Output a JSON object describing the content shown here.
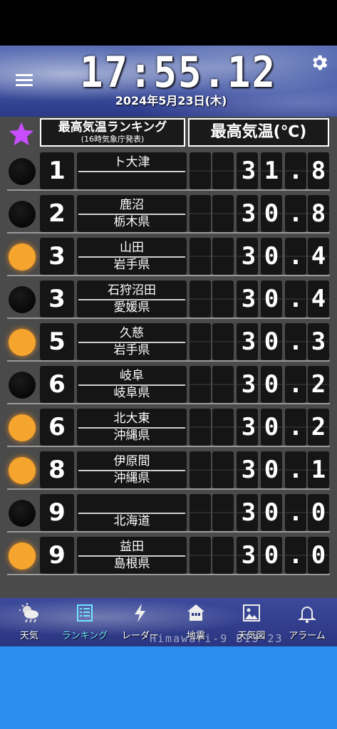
{
  "header": {
    "time": "17:55.12",
    "date": "2024年5月23日(木)"
  },
  "table": {
    "title_left": "最高気温ランキング",
    "subtitle_left": "(16時気象庁発表)",
    "title_right": "最高気温(℃)"
  },
  "rows": [
    {
      "rank": "1",
      "place": "ト大津",
      "pref": "",
      "value": "31.8",
      "marker": "dark"
    },
    {
      "rank": "2",
      "place": "鹿沼",
      "pref": "栃木県",
      "value": "30.8",
      "marker": "dark"
    },
    {
      "rank": "3",
      "place": "山田",
      "pref": "岩手県",
      "value": "30.4",
      "marker": "sun"
    },
    {
      "rank": "3",
      "place": "石狩沼田",
      "pref": "愛媛県",
      "value": "30.4",
      "marker": "dark"
    },
    {
      "rank": "5",
      "place": "久慈",
      "pref": "岩手県",
      "value": "30.3",
      "marker": "sun"
    },
    {
      "rank": "6",
      "place": "岐阜",
      "pref": "岐阜県",
      "value": "30.2",
      "marker": "dark"
    },
    {
      "rank": "6",
      "place": "北大東",
      "pref": "沖縄県",
      "value": "30.2",
      "marker": "sun"
    },
    {
      "rank": "8",
      "place": "伊原間",
      "pref": "沖縄県",
      "value": "30.1",
      "marker": "sun"
    },
    {
      "rank": "9",
      "place": "",
      "pref": "北海道",
      "value": "30.0",
      "marker": "dark"
    },
    {
      "rank": "9",
      "place": "益田",
      "pref": "島根県",
      "value": "30.0",
      "marker": "sun"
    }
  ],
  "tabs": [
    {
      "label": "天気",
      "icon": "weather-icon"
    },
    {
      "label": "ランキング",
      "icon": "list-icon"
    },
    {
      "label": "レーダー",
      "icon": "lightning-icon"
    },
    {
      "label": "地震",
      "icon": "house-icon"
    },
    {
      "label": "天気図",
      "icon": "map-image-icon"
    },
    {
      "label": "アラーム",
      "icon": "bell-icon"
    }
  ],
  "watermark": "Himawari-9 B13 23",
  "colors": {
    "sun": "#f5a52e",
    "active_tab": "#6fe6ff",
    "star": "#c84dff",
    "bottom": "#2c8ff0"
  }
}
